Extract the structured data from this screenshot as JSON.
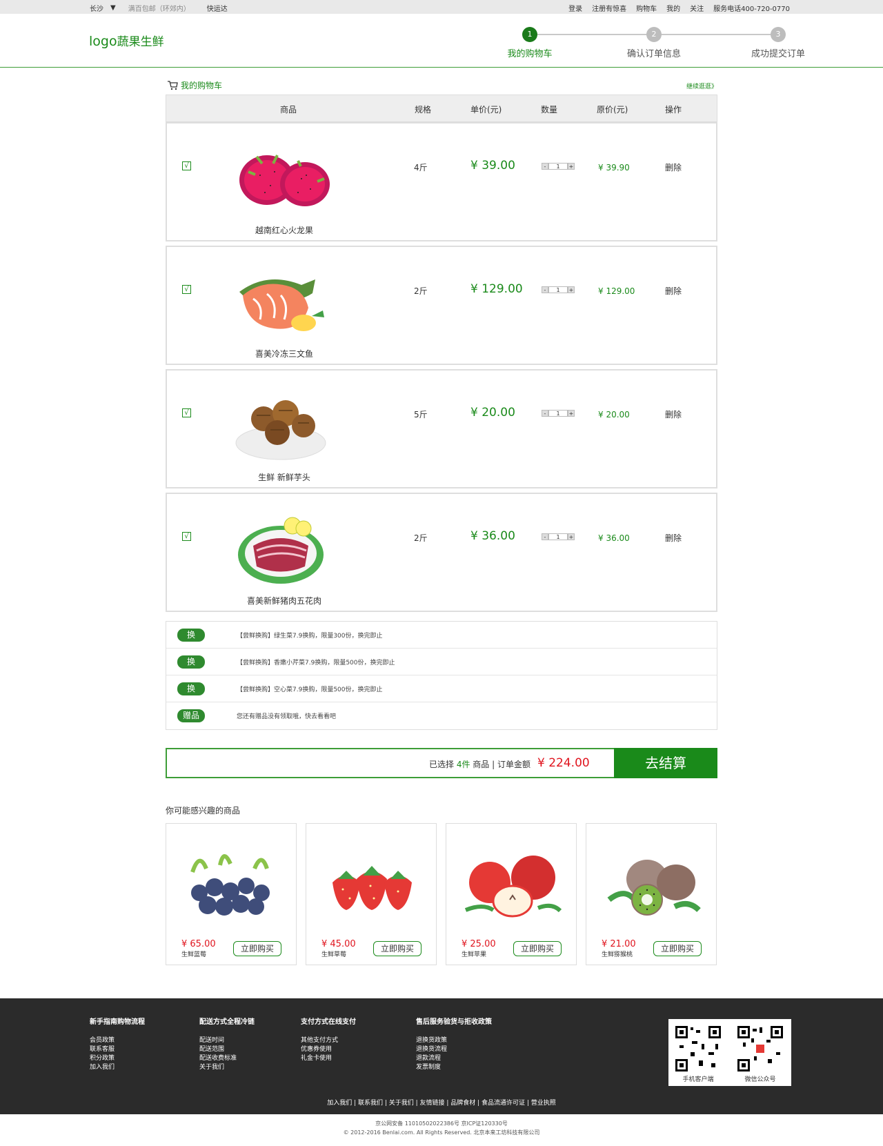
{
  "topbar": {
    "city": "长沙",
    "city_arrow": "▼",
    "free_ship": "满百包邮（环郊内）",
    "express": "快运达",
    "links": [
      "登录",
      "注册有惊喜",
      "购物车",
      "我的",
      "关注",
      "服务电话400-720-0770"
    ]
  },
  "header": {
    "logo_en": "logo",
    "logo_cn": "蔬果生鲜",
    "steps": [
      {
        "num": "1",
        "label": "我的购物车"
      },
      {
        "num": "2",
        "label": "确认订单信息"
      },
      {
        "num": "3",
        "label": "成功提交订单"
      }
    ]
  },
  "cart": {
    "title": "我的购物车",
    "continue": "继续逛逛》",
    "columns": [
      "商品",
      "规格",
      "单价(元)",
      "数量",
      "原价(元)",
      "操作"
    ],
    "items": [
      {
        "name": "越南红心火龙果",
        "spec": "4斤",
        "price": "¥ 39.00",
        "qty": "1",
        "orig": "¥ 39.90",
        "del": "删除",
        "check": "√"
      },
      {
        "name": "喜美冷冻三文鱼",
        "spec": "2斤",
        "price": "¥ 129.00",
        "qty": "1",
        "orig": "¥ 129.00",
        "del": "删除",
        "check": "√"
      },
      {
        "name": "生鲜  新鲜芋头",
        "spec": "5斤",
        "price": "¥ 20.00",
        "qty": "1",
        "orig": "¥ 20.00",
        "del": "删除",
        "check": "√"
      },
      {
        "name": "喜美新鲜猪肉五花肉",
        "spec": "2斤",
        "price": "¥ 36.00",
        "qty": "1",
        "orig": "¥ 36.00",
        "del": "删除",
        "check": "√"
      }
    ],
    "qty_minus": "-",
    "qty_plus": "+"
  },
  "promos": [
    {
      "tag": "换",
      "text": "【尝鲜换购】绿生菜7.9换购，限量300份，换完即止"
    },
    {
      "tag": "换",
      "text": "【尝鲜换购】香嫩小芹菜7.9换购，限量500份，换完即止"
    },
    {
      "tag": "换",
      "text": "【尝鲜换购】空心菜7.9换购，限量500份，换完即止"
    },
    {
      "tag": "赠品",
      "text": "您还有赠品没有领取哦，快去看看吧"
    }
  ],
  "summary": {
    "prefix": "已选择 ",
    "count": "4件",
    "middle": " 商品 | 订单金额 ",
    "total": "¥ 224.00",
    "checkout": "去结算"
  },
  "recommend": {
    "title": "你可能感兴趣的商品",
    "buy_label": "立即购买",
    "items": [
      {
        "price": "¥ 65.00",
        "name": "生鲜蓝莓"
      },
      {
        "price": "¥ 45.00",
        "name": "生鲜草莓"
      },
      {
        "price": "¥ 25.00",
        "name": "生鲜苹果"
      },
      {
        "price": "¥ 21.00",
        "name": "生鲜猕猴桃"
      }
    ]
  },
  "footer": {
    "cols": [
      {
        "head": "新手指南购物流程",
        "items": [
          "会员政策",
          "联系客服",
          "积分政策",
          "加入我们"
        ]
      },
      {
        "head": "配送方式全程冷链",
        "items": [
          "配送时间",
          "配送范围",
          "配送收费标准",
          "关于我们"
        ]
      },
      {
        "head": "支付方式在线支付",
        "items": [
          "其他支付方式",
          "优惠券使用",
          "礼金卡使用"
        ]
      },
      {
        "head": "售后服务验货与拒收政策",
        "items": [
          "退换货政策",
          "退换货流程",
          "退款流程",
          "发票制度"
        ]
      }
    ],
    "qr": [
      "手机客户端",
      "微信公众号"
    ],
    "links": "加入我们  |  联系我们  |  关于我们  |  友情链接  |  品牌食材  |  食品流通许可证  |  营业执照",
    "copy1": "京公网安备 11010502022386号 京ICP证120330号",
    "copy2": "© 2012-2016 Benlai.com. All Rights Reserved. 北京本来工坊科技有限公司"
  },
  "colors": {
    "brand_green": "#1a8a1a",
    "price_red": "#e0141e"
  }
}
